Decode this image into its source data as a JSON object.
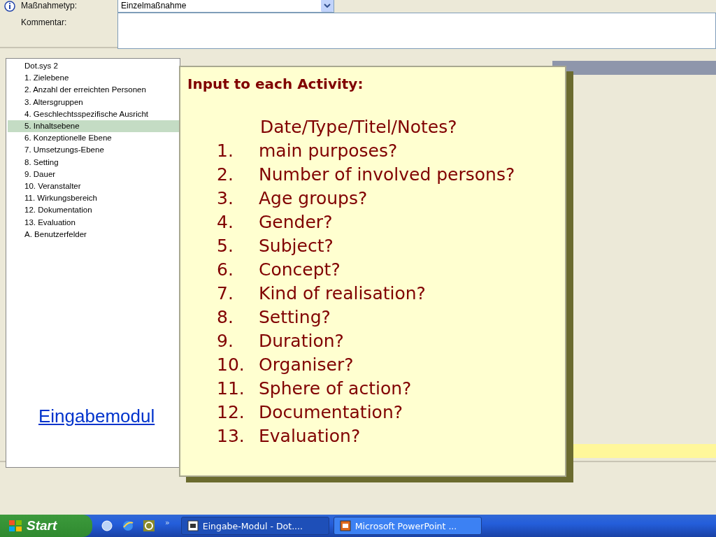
{
  "form": {
    "type_label": "Maßnahmetyp:",
    "type_value": "Einzelmaßnahme",
    "comment_label": "Kommentar:"
  },
  "tree": {
    "items": [
      {
        "label": "Dot.sys 2",
        "selected": false
      },
      {
        "label": "1. Zielebene",
        "selected": false
      },
      {
        "label": "2. Anzahl der erreichten Personen",
        "selected": false
      },
      {
        "label": "3. Altersgruppen",
        "selected": false
      },
      {
        "label": "4. Geschlechtsspezifische Ausricht",
        "selected": false
      },
      {
        "label": "5. Inhaltsebene",
        "selected": true
      },
      {
        "label": "6. Konzeptionelle Ebene",
        "selected": false
      },
      {
        "label": "7. Umsetzungs-Ebene",
        "selected": false
      },
      {
        "label": "8. Setting",
        "selected": false
      },
      {
        "label": "9. Dauer",
        "selected": false
      },
      {
        "label": "10. Veranstalter",
        "selected": false
      },
      {
        "label": "11. Wirkungsbereich",
        "selected": false
      },
      {
        "label": "12. Dokumentation",
        "selected": false
      },
      {
        "label": "13. Evaluation",
        "selected": false
      },
      {
        "label": "A. Benutzerfelder",
        "selected": false
      }
    ]
  },
  "link": "Eingabemodul",
  "callout": {
    "title": "Input to each Activity:",
    "heading": "Date/Type/Titel/Notes?",
    "items": [
      {
        "number": "1.",
        "text": "main purposes?"
      },
      {
        "number": "2.",
        "text": "Number of involved persons?"
      },
      {
        "number": "3.",
        "text": "Age groups?"
      },
      {
        "number": "4.",
        "text": "Gender?"
      },
      {
        "number": "5.",
        "text": "Subject?"
      },
      {
        "number": "6.",
        "text": "Concept?"
      },
      {
        "number": "7.",
        "text": "Kind of realisation?"
      },
      {
        "number": "8.",
        "text": "Setting?"
      },
      {
        "number": "9.",
        "text": "Duration?"
      },
      {
        "number": "10.",
        "text": "Organiser?"
      },
      {
        "number": "11.",
        "text": "Sphere of action?"
      },
      {
        "number": "12.",
        "text": "Documentation?"
      },
      {
        "number": "13.",
        "text": "Evaluation?"
      }
    ]
  },
  "taskbar": {
    "start": "Start",
    "more": "»",
    "tasks": [
      {
        "label": "Eingabe-Modul - Dot....",
        "selected": true
      },
      {
        "label": "Microsoft PowerPoint ...",
        "selected": false
      }
    ]
  }
}
